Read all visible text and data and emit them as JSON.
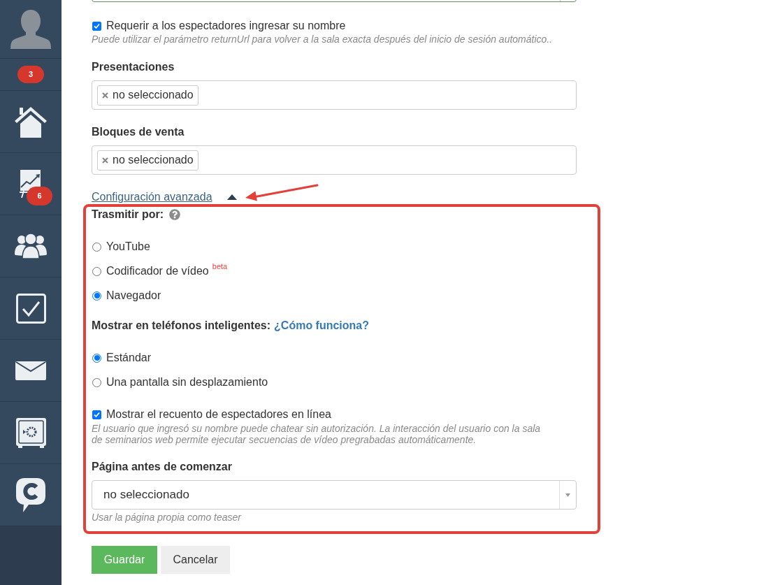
{
  "sidebar": {
    "items": [
      {
        "kind": "avatar"
      },
      {
        "kind": "counter",
        "badge": "3"
      },
      {
        "kind": "home"
      },
      {
        "kind": "chart",
        "badge": "6"
      },
      {
        "kind": "people"
      },
      {
        "kind": "tasks"
      },
      {
        "kind": "mail"
      },
      {
        "kind": "safe"
      },
      {
        "kind": "chat"
      }
    ]
  },
  "form": {
    "require_name": {
      "label": "Requerir a los espectadores ingresar su nombre",
      "checked": true,
      "hint": "Puede utilizar el parámetro returnUrl para volver a la sala exacta después del inicio de sesión automático.."
    },
    "presentations": {
      "label": "Presentaciones",
      "tags": [
        "no seleccionado"
      ]
    },
    "sale_blocks": {
      "label": "Bloques de venta",
      "tags": [
        "no seleccionado"
      ]
    },
    "advanced": {
      "link": "Configuración avanzada",
      "expanded": true,
      "stream_via": {
        "label": "Trasmitir por:",
        "options": [
          {
            "label": "YouTube",
            "selected": false
          },
          {
            "label": "Codificador de vídeo",
            "badge": "beta",
            "selected": false
          },
          {
            "label": "Navegador",
            "selected": true
          }
        ]
      },
      "mobile_display": {
        "label": "Mostrar en teléfonos inteligentes:",
        "link": "¿Cómo funciona?",
        "options": [
          {
            "label": "Estándar",
            "selected": true
          },
          {
            "label": "Una pantalla sin desplazamiento",
            "selected": false
          }
        ]
      },
      "online_count": {
        "label": "Mostrar el recuento de espectadores en línea",
        "checked": true,
        "hint": "El usuario que ingresó su nombre puede chatear sin autorización. La interacción del usuario con la sala de seminarios web permite ejecutar secuencias de vídeo pregrabadas automáticamente."
      },
      "pre_start_page": {
        "label": "Página antes de comenzar",
        "value": "no seleccionado",
        "hint": "Usar la página propia como teaser"
      }
    },
    "buttons": [
      {
        "label": "Guardar",
        "kind": "primary"
      },
      {
        "label": "Cancelar",
        "kind": "secondary"
      }
    ]
  }
}
